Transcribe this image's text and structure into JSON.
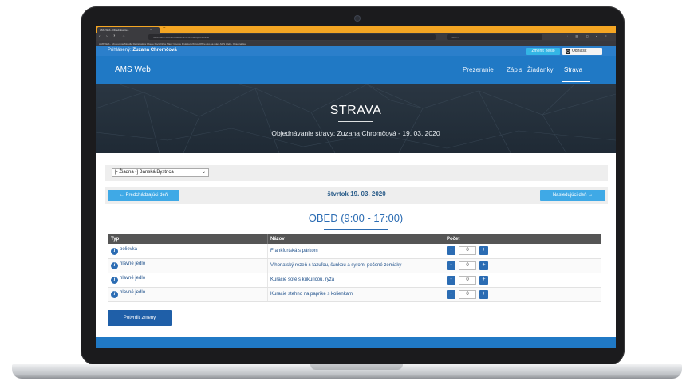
{
  "browser": {
    "tab_title": "AMS Web - Objednávanie...",
    "url": "https://ams.ssvzaroovak.sk/ams/strava/objednavanie",
    "search_placeholder": "Search",
    "bookmarks": "AMS Web - Ubytovanie   Moodle   Registratúra   Obede   Docs   Drive   Mapy Google   DrukNet   Ubytov   Office   Ako sa mám   AMS Web - Objednávka"
  },
  "userbar": {
    "label": "Prihlásený:",
    "username": "Zuzana Chromčová",
    "change_password": "Zmeniť heslo",
    "logout": "Odhlásiť"
  },
  "navbar": {
    "brand": "AMS Web",
    "items": [
      "Prezeranie",
      "Zápis",
      "Žiadanky",
      "Strava"
    ],
    "active": "Strava"
  },
  "hero": {
    "title": "STRAVA",
    "subtitle": "Objednávanie stravy: Zuzana Chromčová - 19. 03. 2020"
  },
  "canteen": {
    "selected": "[- Žiadna -] Banská Bystrica"
  },
  "day_nav": {
    "prev": "← Predchádzajúci deň",
    "date": "štvrtok 19. 03. 2020",
    "next": "Nasledujúci deň →"
  },
  "meal": {
    "title": "OBED (9:00 - 17:00)",
    "columns": [
      "Typ",
      "Názov",
      "Počet"
    ],
    "rows": [
      {
        "type": "polievka",
        "name": "Frankfurtská s párkom",
        "count": "0"
      },
      {
        "type": "hlavné jedlo",
        "name": "Vihorlatský rezeň s fazuľou, šunkou a syrom, pečené zemiaky",
        "count": "0"
      },
      {
        "type": "hlavné jedlo",
        "name": "Kuracie soté s kukuricou, ryža",
        "count": "0"
      },
      {
        "type": "hlavné jedlo",
        "name": "Kuracie stehno na paprike s kolienkami",
        "count": "0"
      }
    ],
    "minus": "-",
    "plus": "+"
  },
  "actions": {
    "confirm": "Potvrdiť zmeny"
  },
  "icons": {
    "info": "i"
  },
  "colors": {
    "brand_blue": "#2079c5",
    "accent_light_blue": "#3fa9e6",
    "header_dark": "#1f2a35",
    "table_header": "#555555",
    "link_blue": "#2b6cb3"
  }
}
